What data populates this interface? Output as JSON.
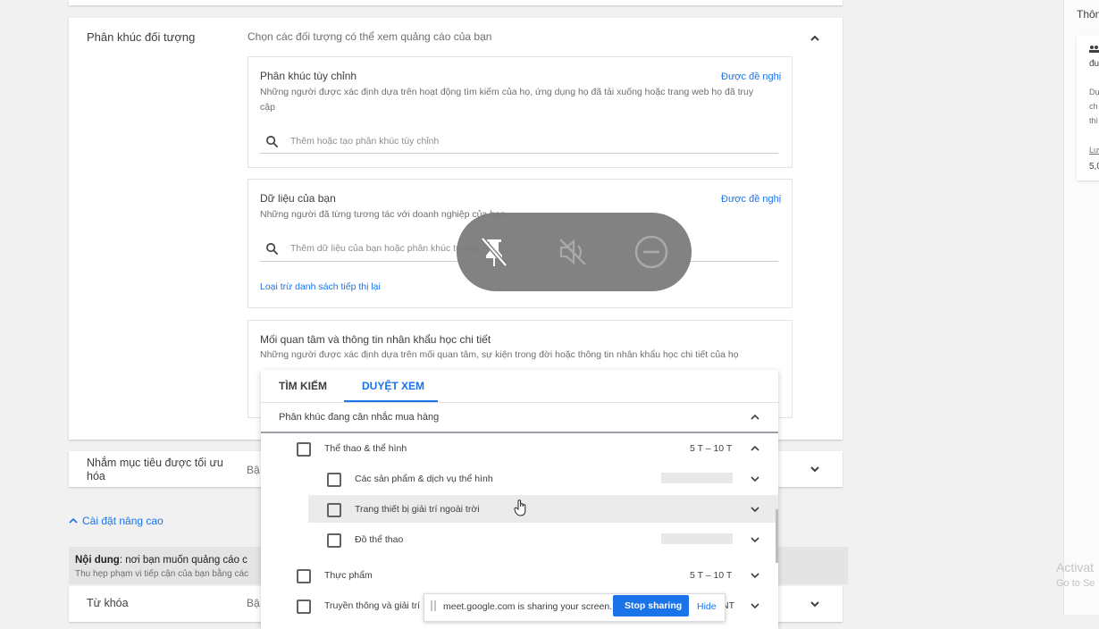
{
  "audience_section": {
    "title": "Phân khúc đối tượng",
    "description": "Chọn các đối tượng có thể xem quảng cáo của bạn"
  },
  "custom_segments": {
    "title": "Phân khúc tùy chỉnh",
    "suggested": "Được đề nghị",
    "description_line1": "Những người được xác định dựa trên hoạt động tìm kiếm của họ, ứng dụng họ đã tải xuống hoặc trang web họ đã truy",
    "description_line2": "cập",
    "search_placeholder": "Thêm hoặc tạo phân khúc tùy chỉnh"
  },
  "your_data": {
    "title": "Dữ liệu của bạn",
    "suggested": "Được đề nghị",
    "description": "Những người đã từng tương tác với doanh nghiệp của bạn",
    "search_placeholder": "Thêm dữ liệu của bạn hoặc phân khúc tương",
    "exclude_link": "Loại trừ danh sách tiếp thị lại"
  },
  "interests": {
    "title": "Mối quan tâm và thông tin nhân khẩu học chi tiết",
    "description": "Những người được xác định dựa trên mối quan tâm, sự kiện trong đời hoặc thông tin nhân khẩu học chi tiết của họ"
  },
  "browse_panel": {
    "tabs": [
      "TÌM KIẾM",
      "DUYỆT XEM"
    ],
    "active_tab": 1,
    "group_title": "Phân khúc đang cân nhắc mua hàng",
    "items": [
      {
        "label": "Thể thao & thể hình",
        "size": "5 T – 10 T",
        "expanded": true
      },
      {
        "label": "Các sản phẩm & dịch vụ thể hình",
        "size": "",
        "child": true
      },
      {
        "label": "Trang thiết bị giải trí ngoài trời",
        "size": "",
        "child": true,
        "hovered": true
      },
      {
        "label": "Đồ thể thao",
        "size": "",
        "child": true
      },
      {
        "label": "Thực phẩm",
        "size": "5 T – 10 T"
      },
      {
        "label": "Truyền thông và giải trí",
        "size": "NT"
      }
    ]
  },
  "optimized_targeting": {
    "title_line1": "Nhắm mục tiêu được tối ưu",
    "title_line2": "hóa",
    "value_prefix": "Bậ"
  },
  "advanced_settings": "Cài đặt nâng cao",
  "content_section": {
    "title_bold": "Nội dung",
    "title_rest": ": nơi bạn muốn quảng cáo c",
    "subtitle": "Thu hẹp phạm vi tiếp cận của bạn bằng các"
  },
  "keywords": {
    "title": "Từ khóa",
    "value_prefix": "Bậ"
  },
  "right_panel": {
    "header": "Thôn",
    "line1": "đu",
    "line2": "Dự",
    "line3": "ch",
    "line4": "thì",
    "line5": "Lư",
    "line6": "5,0"
  },
  "meet_overlay": {
    "icons": [
      "unpin-icon",
      "mute-icon",
      "remove-icon"
    ]
  },
  "screen_share_bar": {
    "message": "meet.google.com is sharing your screen.",
    "stop_label": "Stop sharing",
    "hide_label": "Hide"
  },
  "watermark": {
    "line1": "Activat",
    "line2": "Go to Se"
  },
  "colors": {
    "accent": "#1a73e8",
    "overlay": "#7b7b7b"
  }
}
